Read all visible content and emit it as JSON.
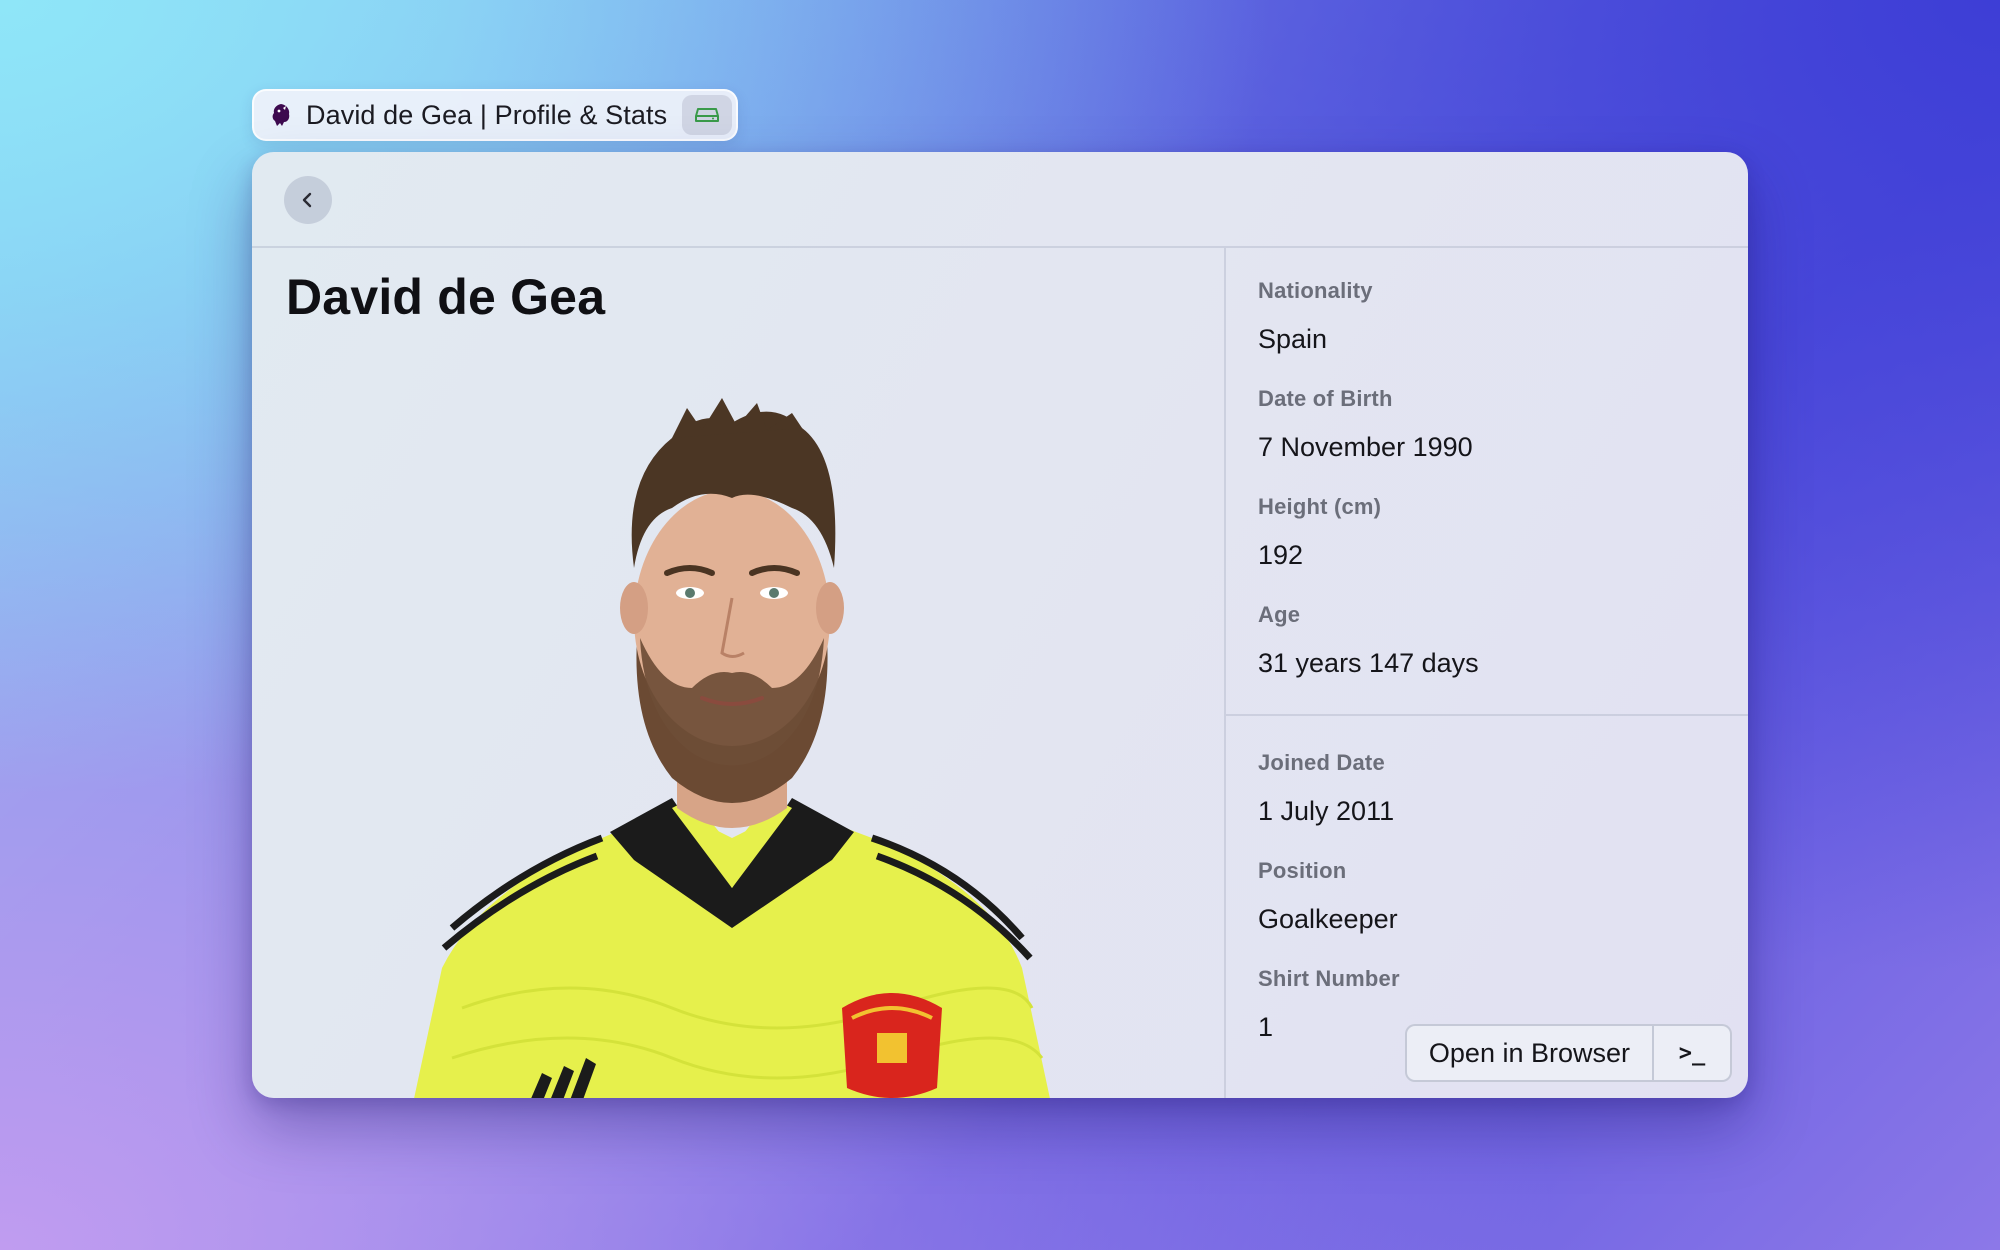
{
  "tab": {
    "title": "David de Gea | Profile & Stats",
    "favicon": "premier-league-lion-icon",
    "action_icon": "storage-drive-icon"
  },
  "header": {
    "back_icon": "chevron-left-icon"
  },
  "player": {
    "name": "David de Gea",
    "photo": "player-portrait"
  },
  "details": {
    "personal": [
      {
        "label": "Nationality",
        "value": "Spain"
      },
      {
        "label": "Date of Birth",
        "value": "7 November 1990"
      },
      {
        "label": "Height (cm)",
        "value": "192"
      },
      {
        "label": "Age",
        "value": "31 years 147 days"
      }
    ],
    "club": [
      {
        "label": "Joined Date",
        "value": "1 July 2011"
      },
      {
        "label": "Position",
        "value": "Goalkeeper"
      },
      {
        "label": "Shirt Number",
        "value": "1"
      }
    ]
  },
  "actions": {
    "open_in_browser": "Open in Browser",
    "terminal": ">_"
  },
  "colors": {
    "kit_yellow": "#e4f04a",
    "kit_collar": "#1b1b1b",
    "badge_red": "#d9251d"
  }
}
